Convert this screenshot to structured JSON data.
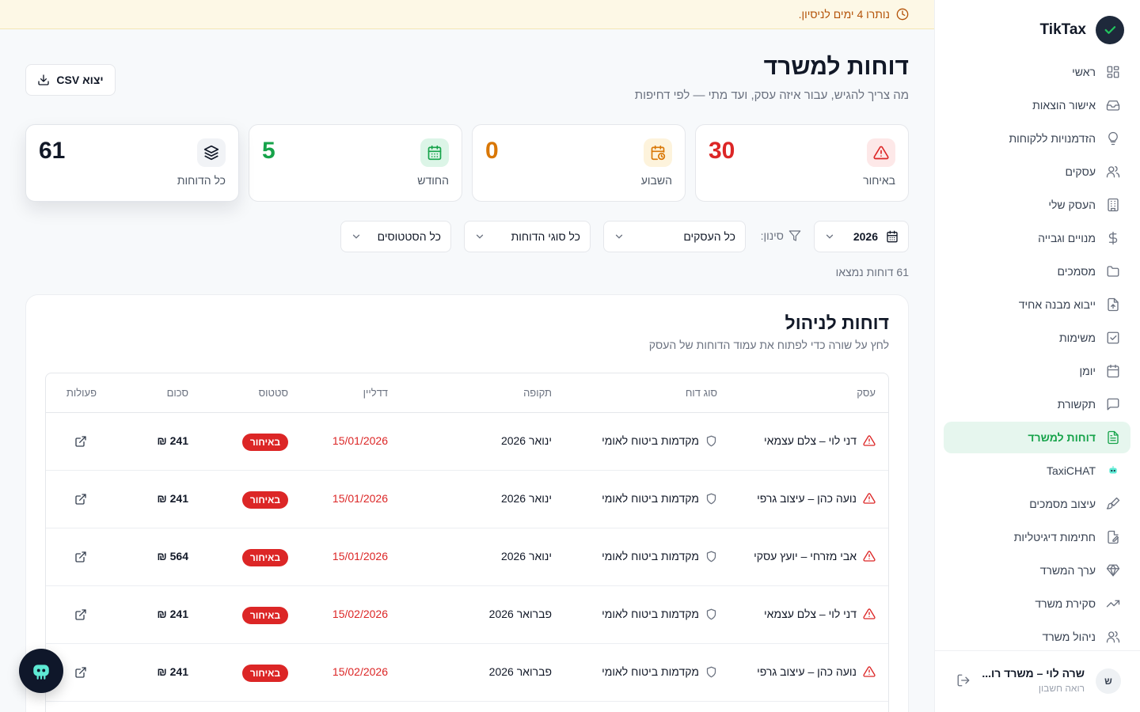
{
  "brand": {
    "name": "TikTax"
  },
  "trial": {
    "text": "נותרו 4 ימים לניסיון."
  },
  "nav": {
    "items": [
      {
        "label": "ראשי",
        "icon": "grid-icon"
      },
      {
        "label": "אישור הוצאות",
        "icon": "inbox-icon"
      },
      {
        "label": "הזדמנויות ללקוחות",
        "icon": "lightbulb-icon"
      },
      {
        "label": "עסקים",
        "icon": "users-icon"
      },
      {
        "label": "העסק שלי",
        "icon": "building-icon"
      },
      {
        "label": "מנויים וגבייה",
        "icon": "dollar-icon"
      },
      {
        "label": "מסמכים",
        "icon": "folder-icon"
      },
      {
        "label": "ייבוא מבנה אחיד",
        "icon": "file-upload-icon"
      },
      {
        "label": "משימות",
        "icon": "checkbox-icon"
      },
      {
        "label": "יומן",
        "icon": "calendar-icon"
      },
      {
        "label": "תקשורת",
        "icon": "chat-icon"
      },
      {
        "label": "דוחות למשרד",
        "icon": "report-icon",
        "active": true
      },
      {
        "label": "TaxiCHAT",
        "icon": "bot-icon"
      },
      {
        "label": "עיצוב מסמכים",
        "icon": "brush-icon"
      },
      {
        "label": "חתימות דיגיטליות",
        "icon": "signature-icon"
      },
      {
        "label": "ערך המשרד",
        "icon": "diamond-icon"
      },
      {
        "label": "סקירת משרד",
        "icon": "trend-icon"
      },
      {
        "label": "ניהול משרד",
        "icon": "team-icon"
      }
    ]
  },
  "user": {
    "initial": "ש",
    "name": "שרה לוי – משרד רו...",
    "role": "רואה חשבון"
  },
  "header": {
    "title": "דוחות למשרד",
    "subtitle": "מה צריך להגיש, עבור איזה עסק, ועד מתי — לפי דחיפות",
    "export_label": "יצוא CSV"
  },
  "stats": [
    {
      "label": "באיחור",
      "value": "30",
      "color": "#dc2626"
    },
    {
      "label": "השבוע",
      "value": "0",
      "color": "#d97706"
    },
    {
      "label": "החודש",
      "value": "5",
      "color": "#16a34a"
    },
    {
      "label": "כל הדוחות",
      "value": "61",
      "color": "#111827"
    }
  ],
  "filters": {
    "year": "2026",
    "caption": "סינון:",
    "business": "כל העסקים",
    "report_type": "כל סוגי הדוחות",
    "status": "כל הסטטוסים"
  },
  "results_count": "61 דוחות נמצאו",
  "table": {
    "title": "דוחות לניהול",
    "subtitle": "לחץ על שורה כדי לפתוח את עמוד הדוחות של העסק",
    "columns": {
      "business": "עסק",
      "type": "סוג דוח",
      "period": "תקופה",
      "deadline": "דדליין",
      "status": "סטטוס",
      "amount": "סכום",
      "actions": "פעולות"
    },
    "rows": [
      {
        "business": "דני לוי – צלם עצמאי",
        "type": "מקדמות ביטוח לאומי",
        "period": "ינואר 2026",
        "deadline": "15/01/2026",
        "status": "באיחור",
        "amount": "241 ₪"
      },
      {
        "business": "נועה כהן – עיצוב גרפי",
        "type": "מקדמות ביטוח לאומי",
        "period": "ינואר 2026",
        "deadline": "15/01/2026",
        "status": "באיחור",
        "amount": "241 ₪"
      },
      {
        "business": "אבי מזרחי – יועץ עסקי",
        "type": "מקדמות ביטוח לאומי",
        "period": "ינואר 2026",
        "deadline": "15/01/2026",
        "status": "באיחור",
        "amount": "564 ₪"
      },
      {
        "business": "דני לוי – צלם עצמאי",
        "type": "מקדמות ביטוח לאומי",
        "period": "פברואר 2026",
        "deadline": "15/02/2026",
        "status": "באיחור",
        "amount": "241 ₪"
      },
      {
        "business": "נועה כהן – עיצוב גרפי",
        "type": "מקדמות ביטוח לאומי",
        "period": "פברואר 2026",
        "deadline": "15/02/2026",
        "status": "באיחור",
        "amount": "241 ₪"
      }
    ]
  }
}
